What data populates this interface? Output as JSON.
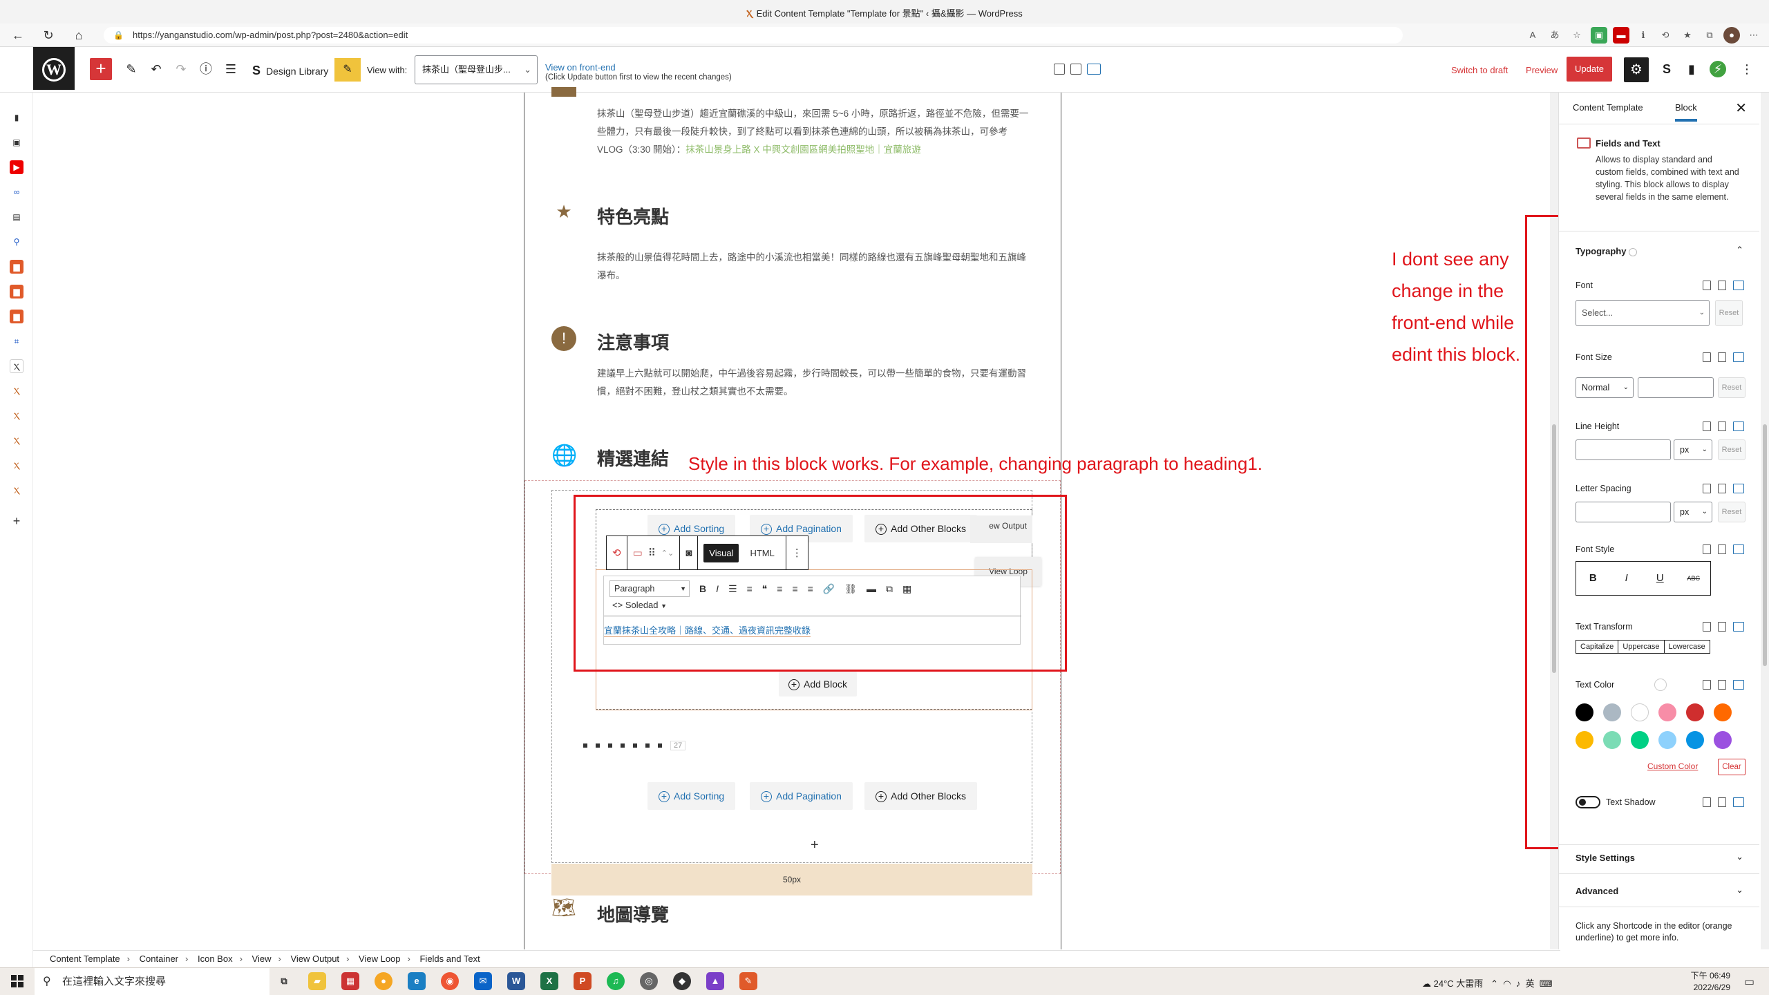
{
  "browser": {
    "tab_title": "Edit Content Template \"Template for 景點\" ‹ 攝&攝影 — WordPress",
    "url": "https://yanganstudio.com/wp-admin/post.php?post=2480&action=edit"
  },
  "toolbar": {
    "design_library": "Design Library",
    "view_with_label": "View with:",
    "view_with_value": "抹茶山（聖母登山步...",
    "view_front": "View on front-end",
    "view_front_note": "(Click Update button first to view the recent changes)",
    "switch_draft": "Switch to draft",
    "preview": "Preview",
    "update": "Update"
  },
  "content": {
    "intro_para": "抹茶山（聖母登山步道）趨近宜蘭礁溪的中級山，來回需 5~6 小時，原路折返，路徑並不危險，但需要一些體力，只有最後一段陡升較快，到了終點可以看到抹茶色連綿的山頭，所以被稱為抹茶山，可參考 VLOG（3:30 開始）：",
    "intro_link": "抹茶山景身上路 X 中興文創園區網美拍照聖地｜宜蘭旅遊",
    "sections": [
      {
        "title": "特色亮點",
        "text": "抹茶般的山景值得花時間上去，路途中的小溪流也相當美！同樣的路線也還有五旗峰聖母朝聖地和五旗峰瀑布。"
      },
      {
        "title": "注意事項",
        "text": "建議早上六點就可以開始爬，中午過後容易起霧，步行時間較長，可以帶一些簡單的食物，只要有運動習慣，絕對不困難，登山杖之類其實也不太需要。"
      },
      {
        "title": "精選連結"
      },
      {
        "title": "地圖導覽"
      }
    ],
    "add_sorting": "Add Sorting",
    "add_pagination": "Add Pagination",
    "add_other_blocks": "Add Other Blocks",
    "view_output": "ew Output",
    "view_loop": "View Loop",
    "visual": "Visual",
    "html": "HTML",
    "paragraph": "Paragraph",
    "soledad": "Soledad",
    "link_text": "宜蘭抹茶山全攻略｜路線、交通、過夜資訊完整收錄",
    "add_block": "Add Block",
    "mini_num": "27",
    "spacer": "50px"
  },
  "annotations": {
    "middle": "Style in this block works. For example, changing paragraph to heading1.",
    "right": [
      "I dont see any",
      "change in the",
      "front-end while",
      "edint this block."
    ]
  },
  "breadcrumb": [
    "Content Template",
    "Container",
    "Icon Box",
    "View",
    "View Output",
    "View Loop",
    "Fields and Text"
  ],
  "sidebar": {
    "tab_template": "Content Template",
    "tab_block": "Block",
    "block_title": "Fields and Text",
    "block_desc": "Allows to display standard and custom fields, combined with text and styling. This block allows to display several fields in the same element.",
    "typography": "Typography",
    "font": "Font",
    "font_placeholder": "Select...",
    "reset": "Reset",
    "font_size": "Font Size",
    "font_size_value": "Normal",
    "line_height": "Line Height",
    "unit": "px",
    "letter_spacing": "Letter Spacing",
    "font_style": "Font Style",
    "text_transform": "Text Transform",
    "transforms": [
      "Capitalize",
      "Uppercase",
      "Lowercase"
    ],
    "text_color": "Text Color",
    "swatches": [
      "#000000",
      "#abb8c3",
      "#ffffff",
      "#f78da7",
      "#cf2e2e",
      "#ff6900",
      "#fcb900",
      "#7bdcb5",
      "#00d084",
      "#8ed1fc",
      "#0693e3",
      "#9b51e0"
    ],
    "custom_color": "Custom Color",
    "clear": "Clear",
    "text_shadow": "Text Shadow",
    "style_settings": "Style Settings",
    "advanced": "Advanced",
    "hint": "Click any Shortcode in the editor (orange underline) to get more info."
  },
  "taskbar": {
    "search": "在這裡輸入文字來搜尋",
    "weather": "24°C 大雷雨",
    "ime": "英",
    "time": "下午 06:49",
    "date": "2022/6/29"
  }
}
